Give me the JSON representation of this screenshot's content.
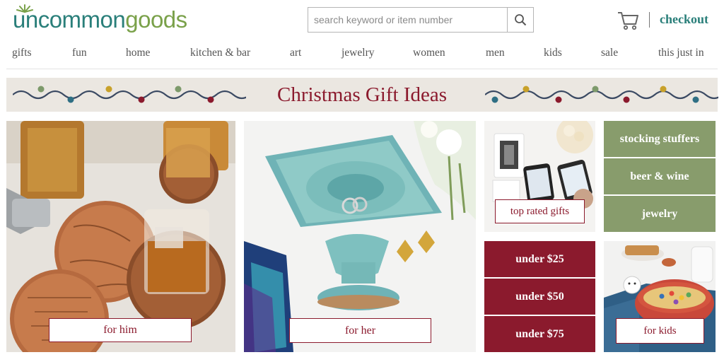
{
  "header": {
    "logo_part1": "uncommon",
    "logo_part2": "goods",
    "search_placeholder": "search keyword or item number",
    "checkout_label": "checkout"
  },
  "nav": [
    "gifts",
    "fun",
    "home",
    "kitchen & bar",
    "art",
    "jewelry",
    "women",
    "men",
    "kids",
    "sale",
    "this just in"
  ],
  "banner": {
    "title": "Christmas Gift Ideas"
  },
  "tiles": {
    "for_him": "for him",
    "for_her": "for her",
    "top_rated": "top rated gifts",
    "for_kids": "for kids"
  },
  "category_buttons": [
    "stocking stuffers",
    "beer & wine",
    "jewelry"
  ],
  "price_buttons": [
    "under $25",
    "under $50",
    "under $75"
  ],
  "colors": {
    "teal": "#2a7f7a",
    "green": "#7aa14a",
    "maroon": "#8b1a2d",
    "sage": "#889c6c",
    "banner_bg": "#ebe7e1"
  },
  "icons": [
    "logo-sun-icon",
    "search-icon",
    "cart-icon",
    "string-lights-decoration"
  ]
}
